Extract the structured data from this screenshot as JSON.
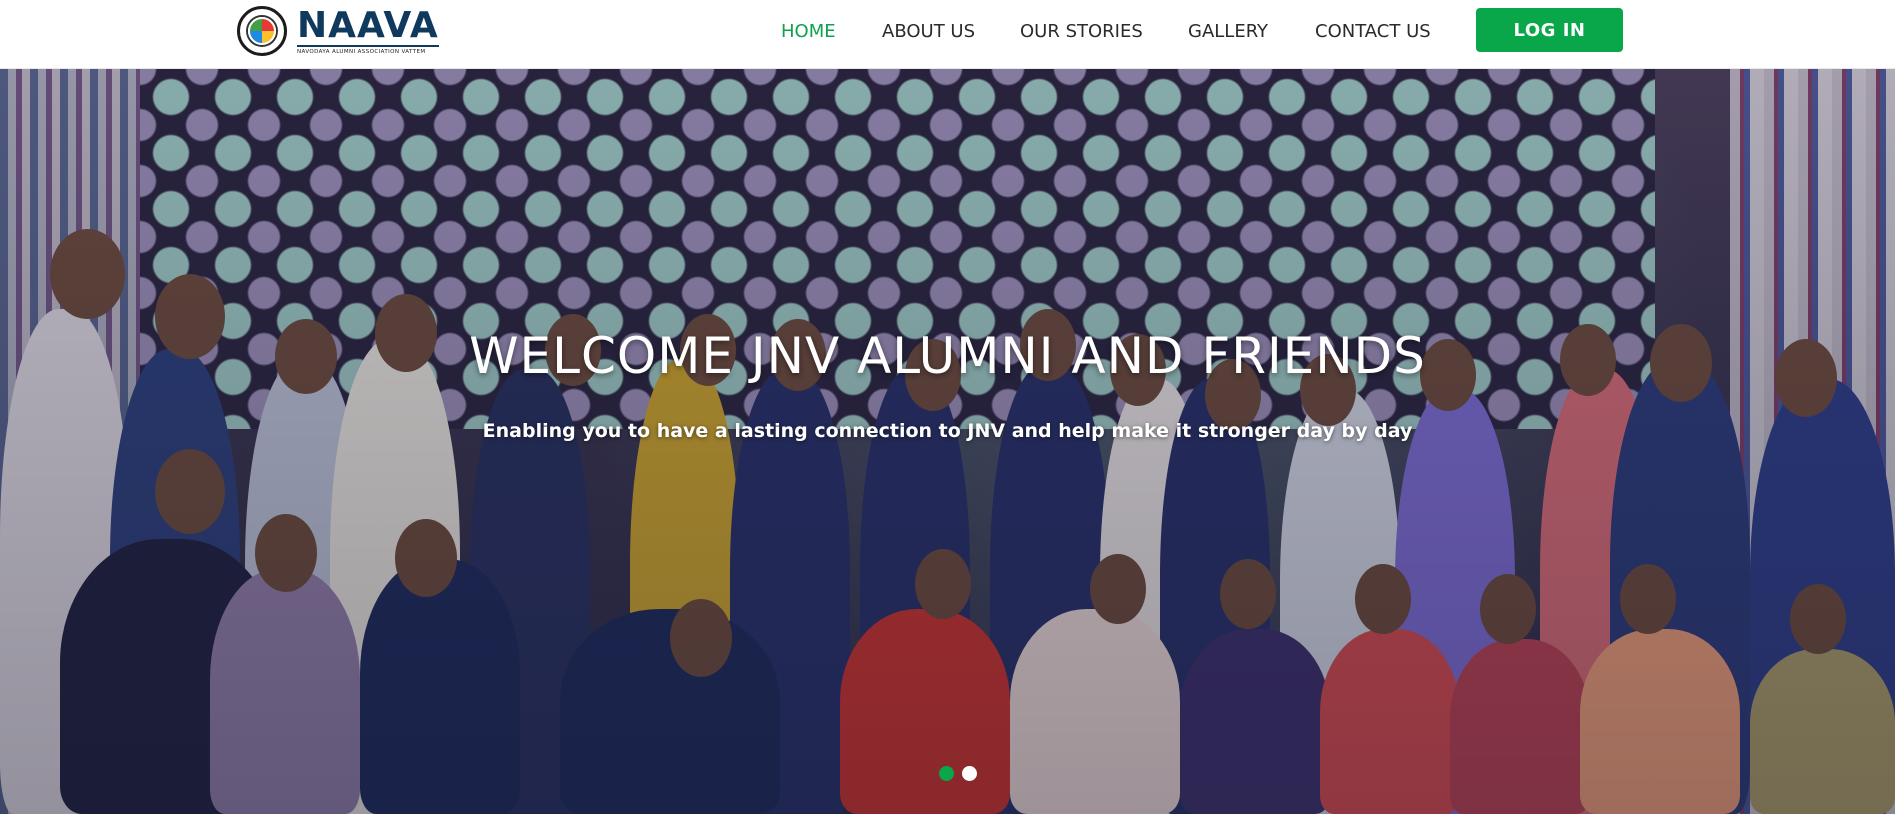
{
  "header": {
    "logo": {
      "name": "NAAVA",
      "tagline": "NAVODAYA ALUMNI ASSOCIATION VATTEM"
    },
    "nav": [
      {
        "label": "HOME",
        "active": true
      },
      {
        "label": "ABOUT US",
        "active": false
      },
      {
        "label": "OUR STORIES",
        "active": false
      },
      {
        "label": "GALLERY",
        "active": false
      },
      {
        "label": "CONTACT US",
        "active": false
      }
    ],
    "login_label": "LOG IN"
  },
  "hero": {
    "title": "WELCOME JNV ALUMNI AND FRIENDS",
    "subtitle": "Enabling you to have a lasting connection to JNV and help make it stronger day by day",
    "slide_count": 2,
    "active_slide": 1
  },
  "colors": {
    "accent": "#0aa64a",
    "nav_active": "#0ea14f",
    "logo": "#10395e"
  }
}
